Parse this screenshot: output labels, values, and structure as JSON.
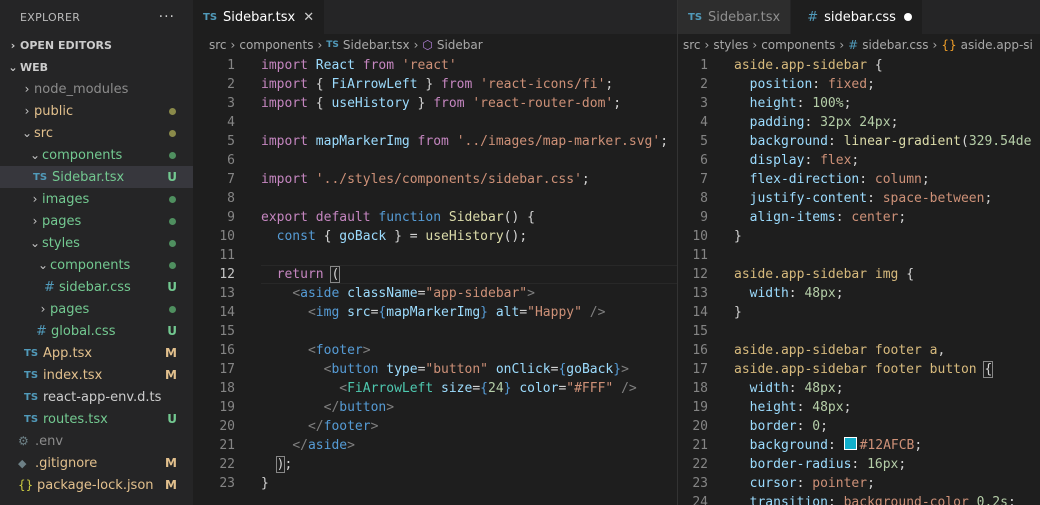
{
  "explorer": {
    "title": "EXPLORER",
    "more": "···",
    "open_editors": "OPEN EDITORS",
    "root": "WEB",
    "items": [
      {
        "label": "node_modules",
        "status": "",
        "kind": "folder"
      },
      {
        "label": "public",
        "status": "dot",
        "kind": "folder"
      },
      {
        "label": "src",
        "status": "dot",
        "kind": "folder-open"
      },
      {
        "label": "components",
        "status": "dot",
        "kind": "folder-open"
      },
      {
        "label": "Sidebar.tsx",
        "status": "U",
        "kind": "ts"
      },
      {
        "label": "images",
        "status": "dot",
        "kind": "folder"
      },
      {
        "label": "pages",
        "status": "dot",
        "kind": "folder"
      },
      {
        "label": "styles",
        "status": "dot",
        "kind": "folder-open"
      },
      {
        "label": "components",
        "status": "dot",
        "kind": "folder-open"
      },
      {
        "label": "sidebar.css",
        "status": "U",
        "kind": "css"
      },
      {
        "label": "pages",
        "status": "dot",
        "kind": "folder"
      },
      {
        "label": "global.css",
        "status": "U",
        "kind": "css"
      },
      {
        "label": "App.tsx",
        "status": "M",
        "kind": "ts"
      },
      {
        "label": "index.tsx",
        "status": "M",
        "kind": "ts"
      },
      {
        "label": "react-app-env.d.ts",
        "status": "",
        "kind": "ts"
      },
      {
        "label": "routes.tsx",
        "status": "U",
        "kind": "ts"
      },
      {
        "label": ".env",
        "status": "",
        "kind": "env"
      },
      {
        "label": ".gitignore",
        "status": "M",
        "kind": "git"
      },
      {
        "label": "package-lock.json",
        "status": "M",
        "kind": "json"
      }
    ]
  },
  "left_editor": {
    "tab_label": "Sidebar.tsx",
    "tab_icon": "TS",
    "breadcrumb": [
      "src",
      "components",
      "Sidebar.tsx",
      "Sidebar"
    ]
  },
  "right_editor": {
    "tab_inactive": "Sidebar.tsx",
    "tab_active": "sidebar.css",
    "breadcrumb": [
      "src",
      "styles",
      "components",
      "sidebar.css",
      "aside.app-si"
    ]
  },
  "colors": {
    "accent": "#12AFCB",
    "untracked": "#73c991",
    "modified": "#e2c08d"
  }
}
